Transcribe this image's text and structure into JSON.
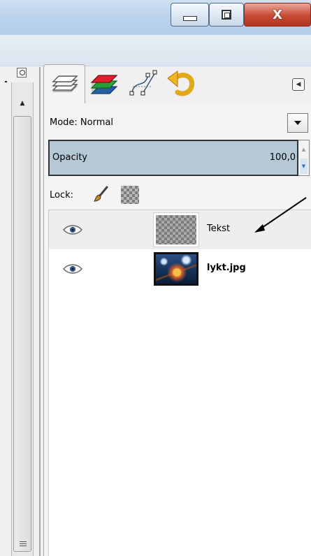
{
  "window": {
    "controls": {
      "minimize_icon": "minimize-icon",
      "maximize_icon": "restore-icon",
      "close_label": "X"
    }
  },
  "layers_dock": {
    "tabs": [
      {
        "name": "layers",
        "icon": "layers-icon",
        "active": true
      },
      {
        "name": "channels",
        "icon": "channels-icon",
        "active": false
      },
      {
        "name": "paths",
        "icon": "paths-icon",
        "active": false
      },
      {
        "name": "undo-history",
        "icon": "undo-icon",
        "active": false
      }
    ],
    "mode_label": "Mode: Normal",
    "opacity_label": "Opacity",
    "opacity_value": "100,0",
    "lock_label": "Lock:",
    "layers": [
      {
        "name": "Tekst",
        "visible": true,
        "selected": true,
        "thumbnail": "transparent"
      },
      {
        "name": "lykt.jpg",
        "visible": true,
        "selected": false,
        "thumbnail": "photo"
      }
    ]
  },
  "colors": {
    "opacity_fill": "#b4c8d6",
    "close_button": "#c74a35",
    "titlebar": "#bcd4ec",
    "selected_row": "#eeeeee"
  }
}
